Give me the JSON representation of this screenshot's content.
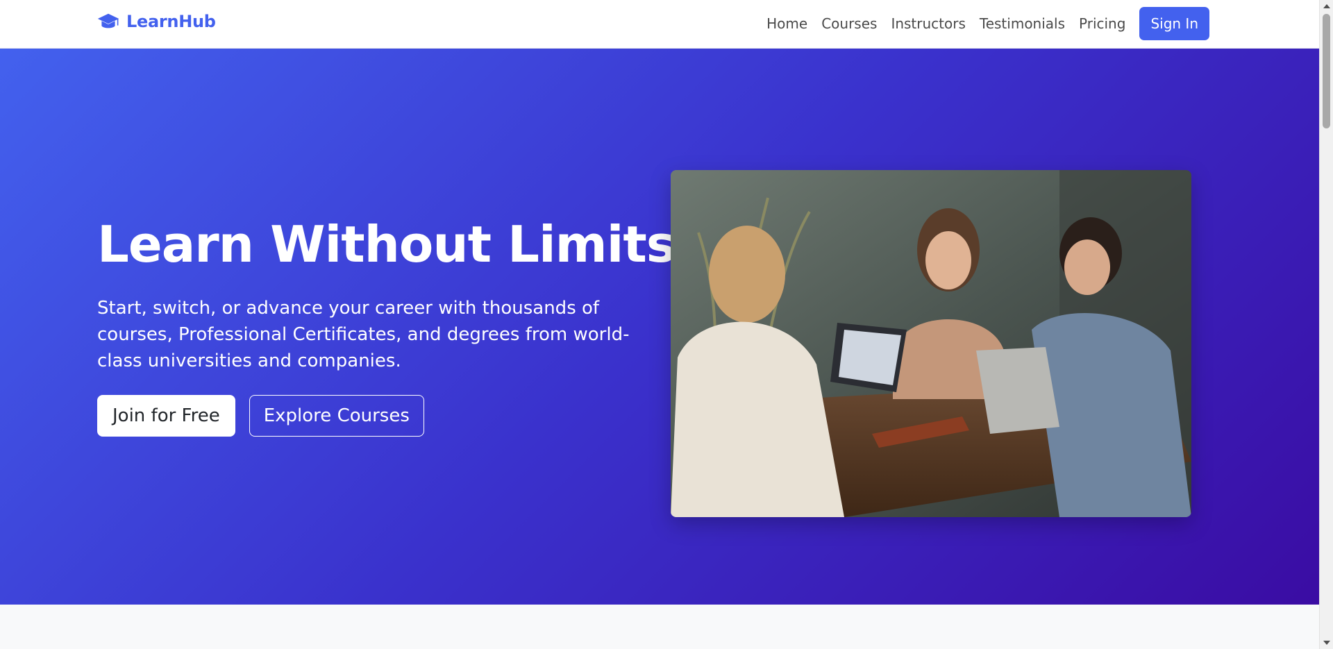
{
  "navbar": {
    "brand": "LearnHub",
    "brand_icon": "graduation-cap-icon",
    "links": [
      "Home",
      "Courses",
      "Instructors",
      "Testimonials",
      "Pricing"
    ],
    "sign_in": "Sign In"
  },
  "hero": {
    "title": "Learn Without Limits",
    "subtitle": "Start, switch, or advance your career with thousands of courses, Professional Certificates, and degrees from world-class universities and companies.",
    "primary_button": "Join for Free",
    "secondary_button": "Explore Courses",
    "image": "group-of-students-with-laptops-photo"
  },
  "colors": {
    "brand": "#4361ee",
    "hero_gradient_start": "#4361ee",
    "hero_gradient_end": "#3a0ca3",
    "section_background": "#f8f9fa"
  }
}
